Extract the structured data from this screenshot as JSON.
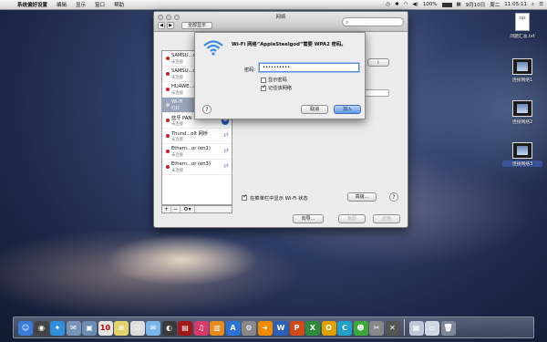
{
  "menubar": {
    "app": "系统偏好设置",
    "items": [
      "编辑",
      "显示",
      "窗口",
      "帮助"
    ],
    "battery": "100%",
    "date": "9月10日",
    "weekday": "周二",
    "time": "11:05:11"
  },
  "window": {
    "title": "网络",
    "show_all": "全部显示"
  },
  "services": [
    {
      "name": "SAMSU...d",
      "sub": "未连接"
    },
    {
      "name": "SAMSU...d",
      "sub": "未连接"
    },
    {
      "name": "HUAWE...d",
      "sub": "未连接"
    },
    {
      "name": "Wi-Fi",
      "sub": "打开"
    },
    {
      "name": "蓝牙 PAN",
      "sub": "未连接"
    },
    {
      "name": "Thund...olt 网桥",
      "sub": "未连接"
    },
    {
      "name": "Ethern...or (en1)",
      "sub": "未连接"
    },
    {
      "name": "Ethern...or (en3)",
      "sub": "未连接"
    }
  ],
  "list_controls": [
    "+",
    "−",
    "⚙▾"
  ],
  "pane": {
    "show_status_label": "在菜单栏中显示 Wi-Fi 状态",
    "advanced_button": "高级...",
    "wizard_button": "向导...",
    "revert_button": "复原",
    "apply_button": "应用",
    "wifi_toggle": "i"
  },
  "sheet": {
    "title": "Wi-Fi 网络“AppleSteelgod”需要 WPA2 密码。",
    "password_label": "密码:",
    "password_value": "••••••••••",
    "show_password": "显示密码",
    "remember_network": "记住该网络",
    "cancel_button": "取消",
    "join_button": "加入"
  },
  "desktop_icons": [
    {
      "label": "问题汇总.txt",
      "doc_text": "TXT"
    },
    {
      "label": "连接网络1"
    },
    {
      "label": "连接网络2"
    },
    {
      "label": "连接网络3"
    }
  ],
  "dock": {
    "items": [
      {
        "name": "finder-icon",
        "glyph": "☺",
        "color": "#3a7bd5"
      },
      {
        "name": "dashboard-icon",
        "glyph": "◉",
        "color": "#444"
      },
      {
        "name": "safari-icon",
        "glyph": "✦",
        "color": "#2f8fd8"
      },
      {
        "name": "mail-icon",
        "glyph": "✉",
        "color": "#7a93b8"
      },
      {
        "name": "photo-icon",
        "glyph": "▣",
        "color": "#6c8cb0"
      },
      {
        "name": "calendar-icon",
        "glyph": "10",
        "color": "#e4e4e4"
      },
      {
        "name": "notes-icon",
        "glyph": "≡",
        "color": "#e3d36a"
      },
      {
        "name": "reminders-icon",
        "glyph": "☑",
        "color": "#ddd"
      },
      {
        "name": "messages-icon",
        "glyph": "✉",
        "color": "#7bb6ea"
      },
      {
        "name": "facetime-icon",
        "glyph": "◐",
        "color": "#3a3a3a"
      },
      {
        "name": "photobooth-icon",
        "glyph": "▤",
        "color": "#a01818"
      },
      {
        "name": "itunes-icon",
        "glyph": "♫",
        "color": "#d33b6b"
      },
      {
        "name": "ibooks-icon",
        "glyph": "▥",
        "color": "#e58a1f"
      },
      {
        "name": "appstore-icon",
        "glyph": "A",
        "color": "#2a72d3"
      },
      {
        "name": "preferences-icon",
        "glyph": "⚙",
        "color": "#888"
      },
      {
        "name": "arrow-icon",
        "glyph": "➜",
        "color": "#f08a00"
      },
      {
        "name": "word-icon",
        "glyph": "W",
        "color": "#2b5fb8"
      },
      {
        "name": "powerpoint-icon",
        "glyph": "P",
        "color": "#d04a1a"
      },
      {
        "name": "excel-icon",
        "glyph": "X",
        "color": "#2d8c3c"
      },
      {
        "name": "outlook-icon",
        "glyph": "O",
        "color": "#e0a000"
      },
      {
        "name": "lync-icon",
        "glyph": "C",
        "color": "#21a0c9"
      },
      {
        "name": "messenger-icon",
        "glyph": "☻",
        "color": "#3aa83a"
      },
      {
        "name": "utility-icon",
        "glyph": "✂",
        "color": "#888"
      },
      {
        "name": "xquartz-icon",
        "glyph": "✕",
        "color": "#555"
      },
      {
        "name": "preview-icon",
        "glyph": "▦",
        "color": "#bfc8d8"
      },
      {
        "name": "documents-icon",
        "glyph": "▭",
        "color": "#d0d6e2"
      },
      {
        "name": "trash-icon",
        "glyph": "🗑",
        "color": "#7e8796"
      }
    ]
  }
}
